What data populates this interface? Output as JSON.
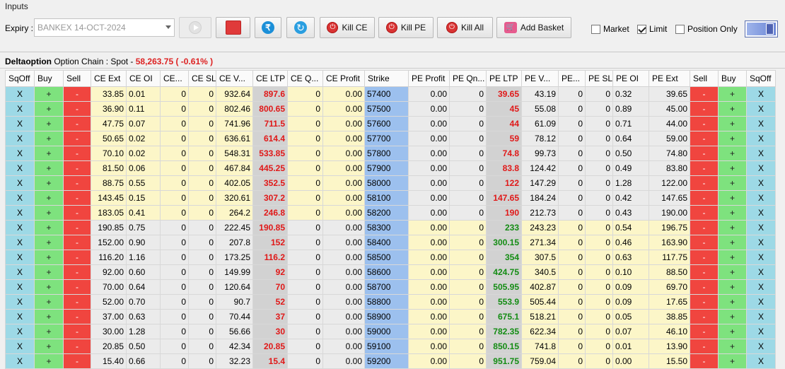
{
  "inputs": {
    "title": "Inputs",
    "expiry_label": "Expiry :",
    "expiry_value": "BANKEX 14-OCT-2024",
    "kill_ce": "Kill CE",
    "kill_pe": "Kill PE",
    "kill_all": "Kill All",
    "add_basket": "Add Basket",
    "market_label": "Market",
    "limit_label": "Limit",
    "position_only_label": "Position Only",
    "market_checked": false,
    "limit_checked": true,
    "position_only_checked": false
  },
  "chain": {
    "brand": "Deltaoption",
    "label": "Option Chain : Spot -",
    "spot": "58,263.75 ( -0.61% )"
  },
  "columns": [
    "SqOff",
    "Buy",
    "Sell",
    "CE Ext",
    "CE OI",
    "CE...",
    "CE SL",
    "CE V...",
    "CE LTP",
    "CE Q...",
    "CE Profit",
    "Strike",
    "PE Profit",
    "PE Qn...",
    "PE LTP",
    "PE V...",
    "PE...",
    "PE SL",
    "PE OI",
    "PE Ext",
    "Sell",
    "Buy",
    "SqOff"
  ],
  "rows": [
    {
      "ce_ext": "33.85",
      "ce_oi": "0.01",
      "ce_col": "0",
      "ce_sl": "0",
      "ce_v": "932.64",
      "ce_ltp": "897.6",
      "ce_q": "0",
      "ce_profit": "0.00",
      "strike": "57400",
      "pe_profit": "0.00",
      "pe_qn": "0",
      "pe_ltp": "39.65",
      "pe_v": "43.19",
      "pe_col": "0",
      "pe_sl": "0",
      "pe_oi": "0.32",
      "pe_ext": "39.65"
    },
    {
      "ce_ext": "36.90",
      "ce_oi": "0.11",
      "ce_col": "0",
      "ce_sl": "0",
      "ce_v": "802.46",
      "ce_ltp": "800.65",
      "ce_q": "0",
      "ce_profit": "0.00",
      "strike": "57500",
      "pe_profit": "0.00",
      "pe_qn": "0",
      "pe_ltp": "45",
      "pe_v": "55.08",
      "pe_col": "0",
      "pe_sl": "0",
      "pe_oi": "0.89",
      "pe_ext": "45.00"
    },
    {
      "ce_ext": "47.75",
      "ce_oi": "0.07",
      "ce_col": "0",
      "ce_sl": "0",
      "ce_v": "741.96",
      "ce_ltp": "711.5",
      "ce_q": "0",
      "ce_profit": "0.00",
      "strike": "57600",
      "pe_profit": "0.00",
      "pe_qn": "0",
      "pe_ltp": "44",
      "pe_v": "61.09",
      "pe_col": "0",
      "pe_sl": "0",
      "pe_oi": "0.71",
      "pe_ext": "44.00"
    },
    {
      "ce_ext": "50.65",
      "ce_oi": "0.02",
      "ce_col": "0",
      "ce_sl": "0",
      "ce_v": "636.61",
      "ce_ltp": "614.4",
      "ce_q": "0",
      "ce_profit": "0.00",
      "strike": "57700",
      "pe_profit": "0.00",
      "pe_qn": "0",
      "pe_ltp": "59",
      "pe_v": "78.12",
      "pe_col": "0",
      "pe_sl": "0",
      "pe_oi": "0.64",
      "pe_ext": "59.00"
    },
    {
      "ce_ext": "70.10",
      "ce_oi": "0.02",
      "ce_col": "0",
      "ce_sl": "0",
      "ce_v": "548.31",
      "ce_ltp": "533.85",
      "ce_q": "0",
      "ce_profit": "0.00",
      "strike": "57800",
      "pe_profit": "0.00",
      "pe_qn": "0",
      "pe_ltp": "74.8",
      "pe_v": "99.73",
      "pe_col": "0",
      "pe_sl": "0",
      "pe_oi": "0.50",
      "pe_ext": "74.80"
    },
    {
      "ce_ext": "81.50",
      "ce_oi": "0.06",
      "ce_col": "0",
      "ce_sl": "0",
      "ce_v": "467.84",
      "ce_ltp": "445.25",
      "ce_q": "0",
      "ce_profit": "0.00",
      "strike": "57900",
      "pe_profit": "0.00",
      "pe_qn": "0",
      "pe_ltp": "83.8",
      "pe_v": "124.42",
      "pe_col": "0",
      "pe_sl": "0",
      "pe_oi": "0.49",
      "pe_ext": "83.80"
    },
    {
      "ce_ext": "88.75",
      "ce_oi": "0.55",
      "ce_col": "0",
      "ce_sl": "0",
      "ce_v": "402.05",
      "ce_ltp": "352.5",
      "ce_q": "0",
      "ce_profit": "0.00",
      "strike": "58000",
      "pe_profit": "0.00",
      "pe_qn": "0",
      "pe_ltp": "122",
      "pe_v": "147.29",
      "pe_col": "0",
      "pe_sl": "0",
      "pe_oi": "1.28",
      "pe_ext": "122.00"
    },
    {
      "ce_ext": "143.45",
      "ce_oi": "0.15",
      "ce_col": "0",
      "ce_sl": "0",
      "ce_v": "320.61",
      "ce_ltp": "307.2",
      "ce_q": "0",
      "ce_profit": "0.00",
      "strike": "58100",
      "pe_profit": "0.00",
      "pe_qn": "0",
      "pe_ltp": "147.65",
      "pe_v": "184.24",
      "pe_col": "0",
      "pe_sl": "0",
      "pe_oi": "0.42",
      "pe_ext": "147.65"
    },
    {
      "ce_ext": "183.05",
      "ce_oi": "0.41",
      "ce_col": "0",
      "ce_sl": "0",
      "ce_v": "264.2",
      "ce_ltp": "246.8",
      "ce_q": "0",
      "ce_profit": "0.00",
      "strike": "58200",
      "pe_profit": "0.00",
      "pe_qn": "0",
      "pe_ltp": "190",
      "pe_v": "212.73",
      "pe_col": "0",
      "pe_sl": "0",
      "pe_oi": "0.43",
      "pe_ext": "190.00"
    },
    {
      "ce_ext": "190.85",
      "ce_oi": "0.75",
      "ce_col": "0",
      "ce_sl": "0",
      "ce_v": "222.45",
      "ce_ltp": "190.85",
      "ce_q": "0",
      "ce_profit": "0.00",
      "strike": "58300",
      "pe_profit": "0.00",
      "pe_qn": "0",
      "pe_ltp": "233",
      "pe_v": "243.23",
      "pe_col": "0",
      "pe_sl": "0",
      "pe_oi": "0.54",
      "pe_ext": "196.75"
    },
    {
      "ce_ext": "152.00",
      "ce_oi": "0.90",
      "ce_col": "0",
      "ce_sl": "0",
      "ce_v": "207.8",
      "ce_ltp": "152",
      "ce_q": "0",
      "ce_profit": "0.00",
      "strike": "58400",
      "pe_profit": "0.00",
      "pe_qn": "0",
      "pe_ltp": "300.15",
      "pe_v": "271.34",
      "pe_col": "0",
      "pe_sl": "0",
      "pe_oi": "0.46",
      "pe_ext": "163.90"
    },
    {
      "ce_ext": "116.20",
      "ce_oi": "1.16",
      "ce_col": "0",
      "ce_sl": "0",
      "ce_v": "173.25",
      "ce_ltp": "116.2",
      "ce_q": "0",
      "ce_profit": "0.00",
      "strike": "58500",
      "pe_profit": "0.00",
      "pe_qn": "0",
      "pe_ltp": "354",
      "pe_v": "307.5",
      "pe_col": "0",
      "pe_sl": "0",
      "pe_oi": "0.63",
      "pe_ext": "117.75"
    },
    {
      "ce_ext": "92.00",
      "ce_oi": "0.60",
      "ce_col": "0",
      "ce_sl": "0",
      "ce_v": "149.99",
      "ce_ltp": "92",
      "ce_q": "0",
      "ce_profit": "0.00",
      "strike": "58600",
      "pe_profit": "0.00",
      "pe_qn": "0",
      "pe_ltp": "424.75",
      "pe_v": "340.5",
      "pe_col": "0",
      "pe_sl": "0",
      "pe_oi": "0.10",
      "pe_ext": "88.50"
    },
    {
      "ce_ext": "70.00",
      "ce_oi": "0.64",
      "ce_col": "0",
      "ce_sl": "0",
      "ce_v": "120.64",
      "ce_ltp": "70",
      "ce_q": "0",
      "ce_profit": "0.00",
      "strike": "58700",
      "pe_profit": "0.00",
      "pe_qn": "0",
      "pe_ltp": "505.95",
      "pe_v": "402.87",
      "pe_col": "0",
      "pe_sl": "0",
      "pe_oi": "0.09",
      "pe_ext": "69.70"
    },
    {
      "ce_ext": "52.00",
      "ce_oi": "0.70",
      "ce_col": "0",
      "ce_sl": "0",
      "ce_v": "90.7",
      "ce_ltp": "52",
      "ce_q": "0",
      "ce_profit": "0.00",
      "strike": "58800",
      "pe_profit": "0.00",
      "pe_qn": "0",
      "pe_ltp": "553.9",
      "pe_v": "505.44",
      "pe_col": "0",
      "pe_sl": "0",
      "pe_oi": "0.09",
      "pe_ext": "17.65"
    },
    {
      "ce_ext": "37.00",
      "ce_oi": "0.63",
      "ce_col": "0",
      "ce_sl": "0",
      "ce_v": "70.44",
      "ce_ltp": "37",
      "ce_q": "0",
      "ce_profit": "0.00",
      "strike": "58900",
      "pe_profit": "0.00",
      "pe_qn": "0",
      "pe_ltp": "675.1",
      "pe_v": "518.21",
      "pe_col": "0",
      "pe_sl": "0",
      "pe_oi": "0.05",
      "pe_ext": "38.85"
    },
    {
      "ce_ext": "30.00",
      "ce_oi": "1.28",
      "ce_col": "0",
      "ce_sl": "0",
      "ce_v": "56.66",
      "ce_ltp": "30",
      "ce_q": "0",
      "ce_profit": "0.00",
      "strike": "59000",
      "pe_profit": "0.00",
      "pe_qn": "0",
      "pe_ltp": "782.35",
      "pe_v": "622.34",
      "pe_col": "0",
      "pe_sl": "0",
      "pe_oi": "0.07",
      "pe_ext": "46.10"
    },
    {
      "ce_ext": "20.85",
      "ce_oi": "0.50",
      "ce_col": "0",
      "ce_sl": "0",
      "ce_v": "42.34",
      "ce_ltp": "20.85",
      "ce_q": "0",
      "ce_profit": "0.00",
      "strike": "59100",
      "pe_profit": "0.00",
      "pe_qn": "0",
      "pe_ltp": "850.15",
      "pe_v": "741.8",
      "pe_col": "0",
      "pe_sl": "0",
      "pe_oi": "0.01",
      "pe_ext": "13.90"
    },
    {
      "ce_ext": "15.40",
      "ce_oi": "0.66",
      "ce_col": "0",
      "ce_sl": "0",
      "ce_v": "32.23",
      "ce_ltp": "15.4",
      "ce_q": "0",
      "ce_profit": "0.00",
      "strike": "59200",
      "pe_profit": "0.00",
      "pe_qn": "0",
      "pe_ltp": "951.75",
      "pe_v": "759.04",
      "pe_col": "0",
      "pe_sl": "0",
      "pe_oi": "0.00",
      "pe_ext": "15.50"
    }
  ],
  "row_buttons": {
    "sqoff": "X",
    "buy": "+",
    "sell": "-"
  },
  "atm_strike": "58200",
  "colors": {
    "ltp_up": "#138c13",
    "ltp_down": "#e01818",
    "itm_bg": "#fcf6c8",
    "otm_bg": "#ebebeb",
    "strike_bg": "#9cc0ee",
    "buy_bg": "#7ee27e",
    "sell_bg": "#f0453f",
    "sqoff_bg": "#9dd9e6"
  }
}
